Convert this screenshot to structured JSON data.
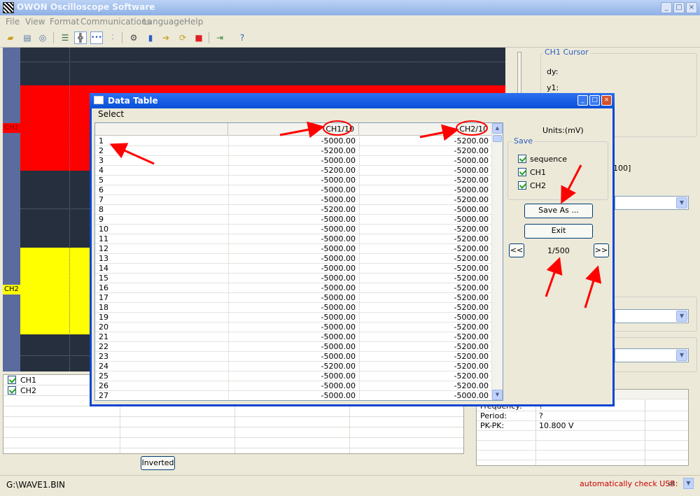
{
  "app": {
    "title": "OWON Oscilloscope Software",
    "menu": [
      "File",
      "View",
      "Format",
      "Communications",
      "Language",
      "Help"
    ]
  },
  "toolbar": {
    "icons": [
      "open-icon",
      "print-icon",
      "print-preview-icon",
      "list-icon",
      "grid-icon",
      "dotted-line-icon",
      "points-icon",
      "settings-icon",
      "cylinder-icon",
      "import-icon",
      "refresh-icon",
      "stop-icon",
      "export-icon",
      "help-icon"
    ]
  },
  "scope": {
    "ch1_label": "CH1",
    "ch2_label": "CH2",
    "colors": {
      "ch1": "#ff0000",
      "ch2": "#ffff00",
      "background": "#262f3d"
    }
  },
  "right_panel": {
    "cursor_title": "CH1 Cursor",
    "dy_label": "dy:",
    "y1_label": "y1:",
    "partial_value": "100]",
    "measure": [
      {
        "label": "Frequency:",
        "value": "?"
      },
      {
        "label": "Period:",
        "value": "?"
      },
      {
        "label": "PK-PK:",
        "value": "10.800 V"
      }
    ]
  },
  "bottom_table": {
    "channels": [
      {
        "label": "CH1",
        "checked": true
      },
      {
        "label": "CH2",
        "checked": true
      }
    ],
    "inverted_label": "Inverted"
  },
  "status": {
    "path": "G:\\WAVE1.BIN",
    "usb": "automatically check USB:"
  },
  "dialog": {
    "title": "Data Table",
    "menu": "Select",
    "columns": [
      "",
      "CH1/10",
      "CH2/10"
    ],
    "rows": [
      [
        "1",
        "-5000.00",
        "-5200.00"
      ],
      [
        "2",
        "-5200.00",
        "-5200.00"
      ],
      [
        "3",
        "-5000.00",
        "-5000.00"
      ],
      [
        "4",
        "-5200.00",
        "-5000.00"
      ],
      [
        "5",
        "-5000.00",
        "-5200.00"
      ],
      [
        "6",
        "-5000.00",
        "-5000.00"
      ],
      [
        "7",
        "-5000.00",
        "-5200.00"
      ],
      [
        "8",
        "-5200.00",
        "-5000.00"
      ],
      [
        "9",
        "-5000.00",
        "-5000.00"
      ],
      [
        "10",
        "-5000.00",
        "-5200.00"
      ],
      [
        "11",
        "-5000.00",
        "-5200.00"
      ],
      [
        "12",
        "-5000.00",
        "-5200.00"
      ],
      [
        "13",
        "-5000.00",
        "-5200.00"
      ],
      [
        "14",
        "-5000.00",
        "-5200.00"
      ],
      [
        "15",
        "-5000.00",
        "-5200.00"
      ],
      [
        "16",
        "-5000.00",
        "-5200.00"
      ],
      [
        "17",
        "-5000.00",
        "-5200.00"
      ],
      [
        "18",
        "-5000.00",
        "-5200.00"
      ],
      [
        "19",
        "-5000.00",
        "-5000.00"
      ],
      [
        "20",
        "-5000.00",
        "-5200.00"
      ],
      [
        "21",
        "-5000.00",
        "-5200.00"
      ],
      [
        "22",
        "-5000.00",
        "-5200.00"
      ],
      [
        "23",
        "-5000.00",
        "-5200.00"
      ],
      [
        "24",
        "-5200.00",
        "-5200.00"
      ],
      [
        "25",
        "-5000.00",
        "-5200.00"
      ],
      [
        "26",
        "-5000.00",
        "-5200.00"
      ],
      [
        "27",
        "-5000.00",
        "-5000.00"
      ]
    ],
    "units": "Units:(mV)",
    "save_group": "Save",
    "save_options": [
      {
        "label": "sequence",
        "checked": true
      },
      {
        "label": "CH1",
        "checked": true
      },
      {
        "label": "CH2",
        "checked": true
      }
    ],
    "save_as_label": "Save As ...",
    "exit_label": "Exit",
    "prev_label": "<<",
    "next_label": ">>",
    "page": "1/500"
  },
  "annotation_color": "#ff0000"
}
